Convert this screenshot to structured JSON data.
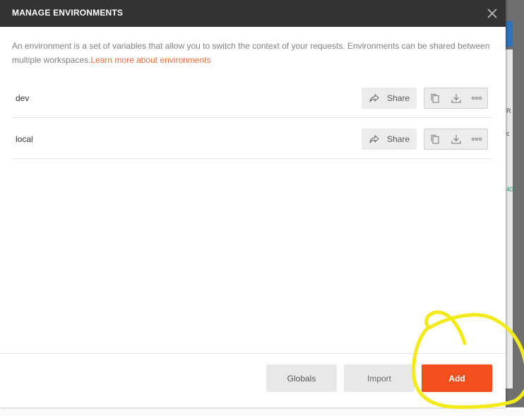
{
  "colors": {
    "header_bg": "#333333",
    "accent": "#f24e1e",
    "link": "#f26b3a",
    "highlight": "#f3ea1a"
  },
  "modal": {
    "title": "MANAGE ENVIRONMENTS",
    "close_icon": "close-icon",
    "description": "An environment is a set of variables that allow you to switch the context of your requests. Environments can be shared between multiple workspaces.",
    "learn_more_link": "Learn more about environments"
  },
  "environments": [
    {
      "name": "dev",
      "share_label": "Share"
    },
    {
      "name": "local",
      "share_label": "Share"
    }
  ],
  "row_actions_icons": [
    "duplicate-icon",
    "download-icon",
    "more-icon"
  ],
  "footer": {
    "globals_label": "Globals",
    "import_label": "Import",
    "add_label": "Add"
  },
  "background": {
    "snippets": [
      "R",
      "c",
      "40"
    ]
  }
}
